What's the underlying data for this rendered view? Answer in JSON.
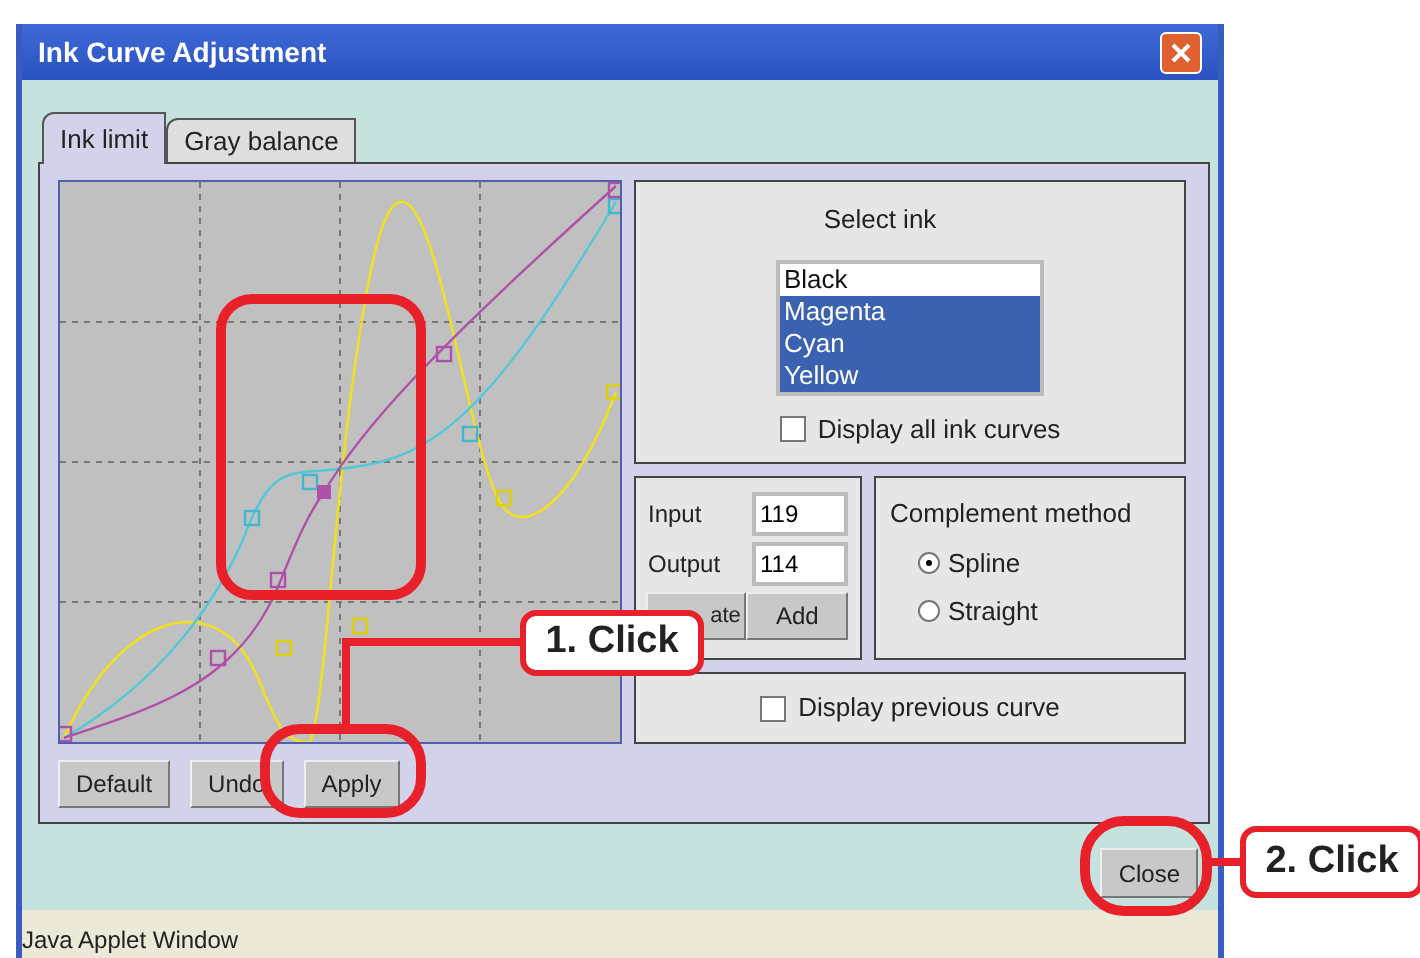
{
  "window": {
    "title": "Ink Curve Adjustment"
  },
  "tabs": [
    {
      "label": "Ink limit",
      "selected": true
    },
    {
      "label": "Gray balance",
      "selected": false
    }
  ],
  "curve_buttons": [
    {
      "label": "Default"
    },
    {
      "label": "Undo"
    },
    {
      "label": "Apply"
    }
  ],
  "select_ink": {
    "label": "Select ink",
    "items": [
      {
        "label": "Black",
        "selected": false
      },
      {
        "label": "Magenta",
        "selected": true
      },
      {
        "label": "Cyan",
        "selected": true
      },
      {
        "label": "Yellow",
        "selected": true
      }
    ],
    "display_all": {
      "label": "Display all ink curves",
      "checked": false
    }
  },
  "point": {
    "input_label": "Input",
    "input_value": "119",
    "output_label": "Output",
    "output_value": "114",
    "buttons": [
      "ate",
      "Add"
    ]
  },
  "complement": {
    "title": "Complement method",
    "options": [
      {
        "label": "Spline",
        "selected": true
      },
      {
        "label": "Straight",
        "selected": false
      }
    ]
  },
  "display_previous": {
    "label": "Display previous curve",
    "checked": false
  },
  "close_button": "Close",
  "status_bar": "Java Applet Window",
  "callouts": [
    {
      "label": "1. Click"
    },
    {
      "label": "2. Click"
    }
  ]
}
